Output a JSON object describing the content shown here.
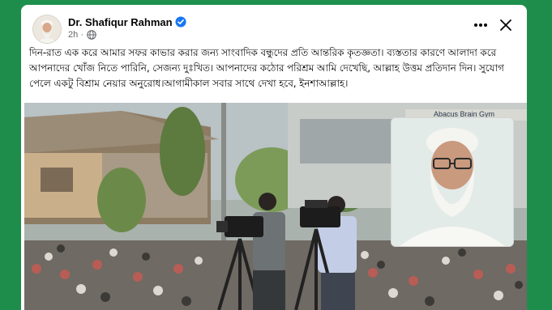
{
  "post": {
    "author": "Dr. Shafiqur Rahman",
    "time": "2h",
    "separator": "·",
    "body": "দিন-রাত এক করে আমার সফর কাভার করার জন্য সাংবাদিক বন্ধুদের প্রতি আন্তরিক কৃতজ্ঞতা। ব্যস্ততার কারণে আলাদা করে আপনাদের খোঁজ নিতে পারিনি, সেজন্য দুঃখিত। আপনাদের কঠোর পরিশ্রম আমি দেখেছি, আল্লাহ উত্তম প্রতিদান দিন। সুযোগ পেলে একটু বিশ্রাম নেয়ার অনুরোধ।আগামীকাল সবার সাথে দেখা হবে, ইনশাআল্লাহ।"
  },
  "photo": {
    "sign_text": "Abacus Brain Gym"
  },
  "icons": {
    "verified": "verified-badge-icon",
    "audience": "globe-icon",
    "more": "more-options-icon",
    "close": "close-icon"
  },
  "colors": {
    "frame": "#1e8c4b",
    "verified": "#1877f2",
    "meta_text": "#65676b"
  }
}
